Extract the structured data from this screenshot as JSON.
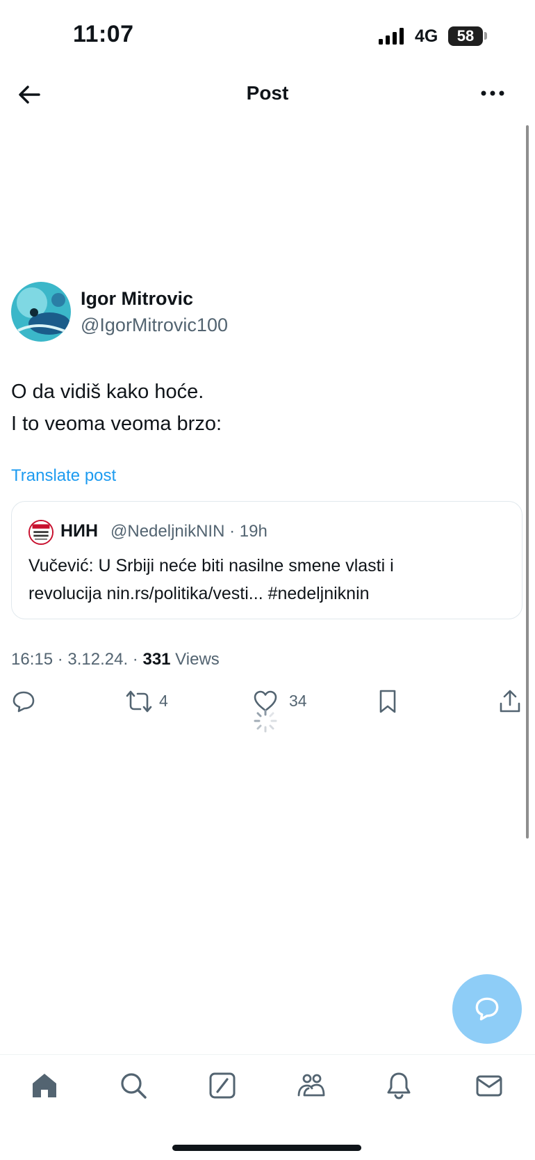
{
  "status_bar": {
    "time": "11:07",
    "network": "4G",
    "battery": "58"
  },
  "header": {
    "title": "Post"
  },
  "post": {
    "author_name": "Igor Mitrovic",
    "author_handle": "@IgorMitrovic100",
    "text_line1": "O da vidiš kako hoće.",
    "text_line2": "I to veoma veoma brzo:",
    "translate_label": "Translate post",
    "quote": {
      "name": "НИН",
      "handle_time": "@NedeljnikNIN · 19h",
      "text_line1": "Vučević: U Srbiji neće biti nasilne smene vlasti i",
      "text_line2": "revolucija nin.rs/politika/vesti... #nedeljniknin"
    },
    "meta": {
      "time_date": "16:15 · 3.12.24. · ",
      "views_count": "331",
      "views_label": " Views"
    },
    "actions": {
      "reposts": "4",
      "likes": "34"
    }
  },
  "colors": {
    "accent": "#1d9bf0",
    "fab": "#8ecdf7",
    "secondary_text": "#536471"
  },
  "tabs": [
    "home-icon",
    "search-icon",
    "grok-icon",
    "communities-icon",
    "notifications-icon",
    "messages-icon"
  ]
}
